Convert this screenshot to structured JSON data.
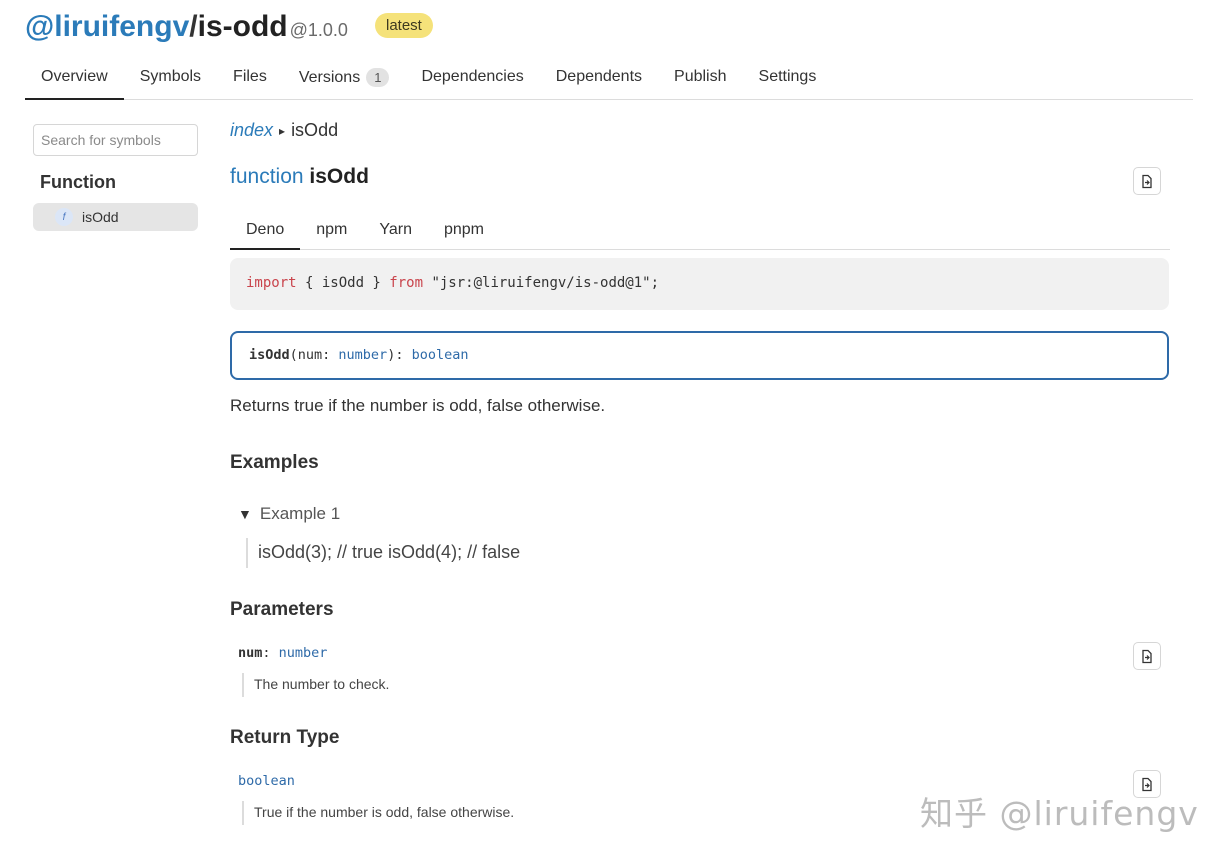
{
  "package": {
    "scope": "@liruifengv",
    "slash": "/",
    "name": "is-odd",
    "version": "@1.0.0",
    "badge": "latest"
  },
  "tabs": [
    {
      "label": "Overview",
      "active": true
    },
    {
      "label": "Symbols"
    },
    {
      "label": "Files"
    },
    {
      "label": "Versions",
      "count": "1"
    },
    {
      "label": "Dependencies"
    },
    {
      "label": "Dependents"
    },
    {
      "label": "Publish"
    },
    {
      "label": "Settings"
    }
  ],
  "sidebar": {
    "search_placeholder": "Search for symbols",
    "heading": "Function",
    "items": [
      {
        "kind": "f",
        "label": "isOdd"
      }
    ]
  },
  "breadcrumb": {
    "root": "index",
    "separator": "▸",
    "current": "isOdd"
  },
  "symbol": {
    "keyword": "function",
    "name": "isOdd",
    "source_icon": "source-file-icon"
  },
  "install_tabs": [
    "Deno",
    "npm",
    "Yarn",
    "pnpm"
  ],
  "import_code": {
    "kw_import": "import",
    "braces": " { isOdd } ",
    "kw_from": "from",
    "specifier": " \"jsr:@liruifengv/is-odd@1\";"
  },
  "signature": {
    "name": "isOdd",
    "open": "(num: ",
    "param_type": "number",
    "close": "): ",
    "return_type": "boolean"
  },
  "description": "Returns true if the number is odd, false otherwise.",
  "examples": {
    "heading": "Examples",
    "items": [
      {
        "title": "Example 1",
        "code": "isOdd(3); // true isOdd(4); // false"
      }
    ]
  },
  "parameters": {
    "heading": "Parameters",
    "items": [
      {
        "name": "num",
        "colon": ": ",
        "type": "number",
        "doc": "The number to check."
      }
    ]
  },
  "return_type": {
    "heading": "Return Type",
    "type": "boolean",
    "doc": "True if the number is odd, false otherwise."
  },
  "watermark": "知乎 @liruifengv"
}
